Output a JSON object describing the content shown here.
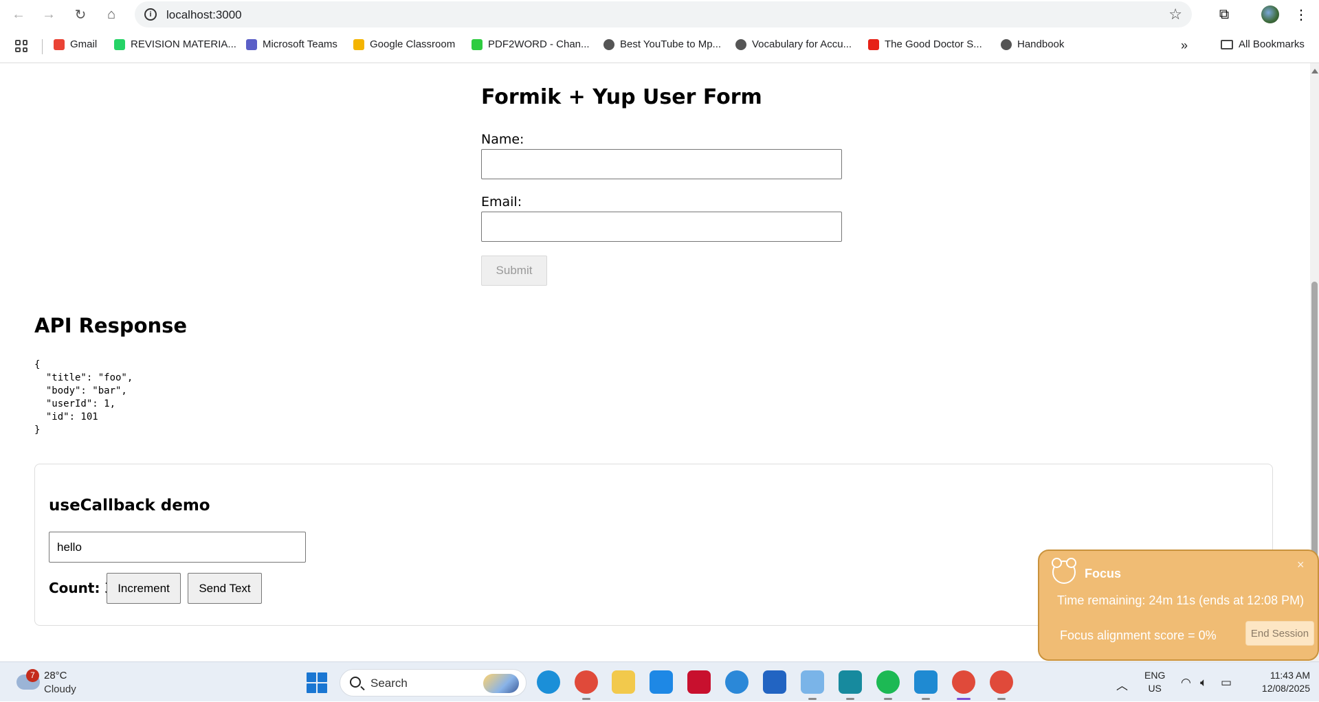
{
  "browser": {
    "url": "localhost:3000",
    "bookmarks": [
      {
        "label": "Gmail",
        "icon": "gmail-icon",
        "color": "#ea4335"
      },
      {
        "label": "REVISION MATERIA...",
        "icon": "whatsapp-icon",
        "color": "#25d366"
      },
      {
        "label": "Microsoft Teams",
        "icon": "teams-icon",
        "color": "#5b5fc7"
      },
      {
        "label": "Google Classroom",
        "icon": "classroom-icon",
        "color": "#f4b400"
      },
      {
        "label": "PDF2WORD - Chan...",
        "icon": "pdf2word-icon",
        "color": "#2ecc40"
      },
      {
        "label": "Best YouTube to Mp...",
        "icon": "globe-icon",
        "color": "#555555"
      },
      {
        "label": "Vocabulary for Accu...",
        "icon": "globe-icon",
        "color": "#555555"
      },
      {
        "label": "The Good Doctor S...",
        "icon": "seven-plus-icon",
        "color": "#e62117"
      },
      {
        "label": "Handbook",
        "icon": "globe-icon",
        "color": "#555555"
      }
    ],
    "more_bookmarks": "»",
    "all_bookmarks": "All Bookmarks"
  },
  "form": {
    "title": "Formik + Yup User Form",
    "name_label": "Name:",
    "name_value": "",
    "email_label": "Email:",
    "email_value": "",
    "submit_label": "Submit"
  },
  "api": {
    "title": "API Response",
    "json": "{\n  \"title\": \"foo\",\n  \"body\": \"bar\",\n  \"userId\": 1,\n  \"id\": 101\n}"
  },
  "demo": {
    "title": "useCallback demo",
    "input_value": "hello",
    "count_label": "Count:",
    "count_value": "3",
    "increment_label": "Increment",
    "send_label": "Send Text"
  },
  "focus_popup": {
    "title": "Focus",
    "close": "×",
    "remaining": "Time remaining: 24m 11s (ends at 12:08 PM)",
    "score": "Focus alignment score = 0%",
    "end_label": "End Session"
  },
  "taskbar": {
    "weather_badge": "7",
    "temperature": "28°C",
    "condition": "Cloudy",
    "search_label": "Search",
    "lang_line1": "ENG",
    "lang_line2": "US",
    "time": "11:43 AM",
    "date": "12/08/2025",
    "apps": [
      {
        "name": "edge-icon",
        "color": "#1b8fd8"
      },
      {
        "name": "chrome-profile-icon",
        "color": "#e04a3a"
      },
      {
        "name": "file-explorer-icon",
        "color": "#f2c94c"
      },
      {
        "name": "myhp-icon",
        "color": "#1e88e5"
      },
      {
        "name": "mcafee-icon",
        "color": "#c8102e"
      },
      {
        "name": "help-icon",
        "color": "#2b88d8"
      },
      {
        "name": "microsoft-store-icon",
        "color": "#2264c2"
      },
      {
        "name": "snipping-tool-icon",
        "color": "#7ab4e8"
      },
      {
        "name": "surfshark-icon",
        "color": "#178a9e"
      },
      {
        "name": "spotify-icon",
        "color": "#1db954"
      },
      {
        "name": "vscode-icon",
        "color": "#1f8ad2"
      },
      {
        "name": "chrome-icon",
        "color": "#e04a3a"
      },
      {
        "name": "chrome-profile-2-icon",
        "color": "#e04a3a"
      }
    ]
  }
}
